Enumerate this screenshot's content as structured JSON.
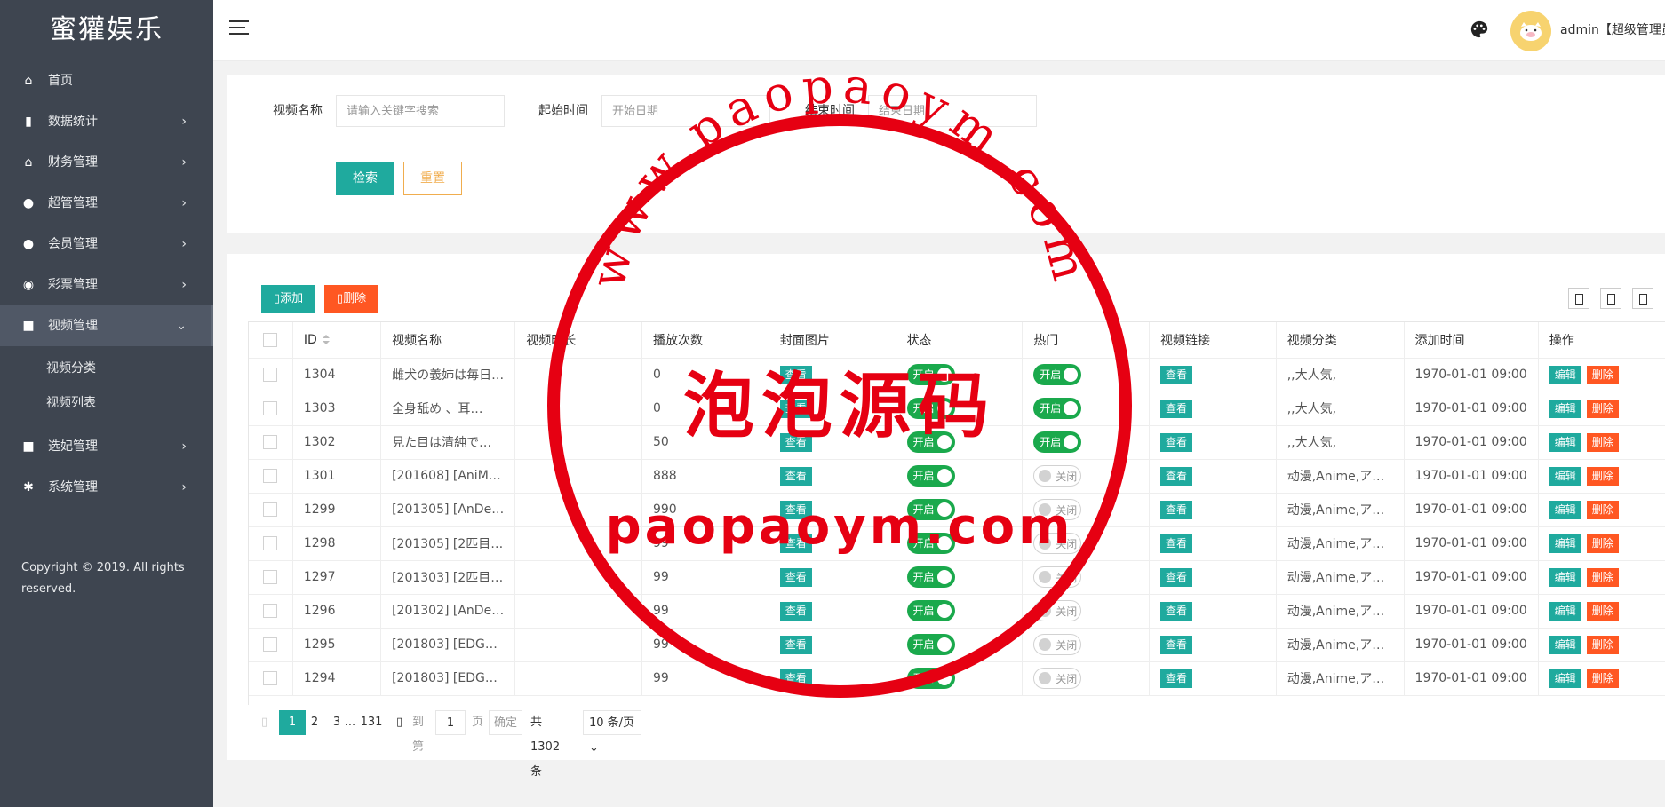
{
  "brand": "蜜獾娱乐",
  "sidebar": {
    "items": [
      {
        "label": "首页",
        "icon": "home-icon"
      },
      {
        "label": "数据统计",
        "icon": "bar-chart-icon"
      },
      {
        "label": "财务管理",
        "icon": "bank-icon"
      },
      {
        "label": "超管管理",
        "icon": "user-icon"
      },
      {
        "label": "会员管理",
        "icon": "users-icon"
      },
      {
        "label": "彩票管理",
        "icon": "gamepad-icon"
      },
      {
        "label": "视频管理",
        "icon": "video-icon"
      },
      {
        "label": "选妃管理",
        "icon": "video-icon"
      },
      {
        "label": "系统管理",
        "icon": "gear-icon"
      }
    ],
    "subitems": [
      "视频分类",
      "视频列表"
    ],
    "copyright": "Copyright © 2019. All rights reserved."
  },
  "header": {
    "user": "admin【超级管理员】"
  },
  "search": {
    "name_label": "视频名称",
    "name_placeholder": "请输入关键字搜索",
    "start_label": "起始时间",
    "start_placeholder": "开始日期",
    "end_label": "结束时间",
    "end_placeholder": "结束日期",
    "search_btn": "检索",
    "reset_btn": "重置"
  },
  "toolbar": {
    "add_label": "添加",
    "delete_label": "删除"
  },
  "table": {
    "columns": [
      "ID",
      "视频名称",
      "视频时长",
      "播放次数",
      "封面图片",
      "状态",
      "热门",
      "视频链接",
      "视频分类",
      "添加时间",
      "操作"
    ],
    "view_label": "查看",
    "on_label": "开启",
    "off_label": "关闭",
    "edit_label": "编辑",
    "delete_label": "删除",
    "rows": [
      {
        "id": "1304",
        "name": "雌犬の義姉は毎日…",
        "duration": "",
        "plays": "0",
        "status": true,
        "hot": true,
        "category": ",,大人気,",
        "added": "1970-01-01 09:00"
      },
      {
        "id": "1303",
        "name": "全身舐め 、耳…",
        "duration": "",
        "plays": "0",
        "status": true,
        "hot": true,
        "category": ",,大人気,",
        "added": "1970-01-01 09:00"
      },
      {
        "id": "1302",
        "name": "見た目は清純で…",
        "duration": "",
        "plays": "50",
        "status": true,
        "hot": true,
        "category": ",,大人気,",
        "added": "1970-01-01 09:00"
      },
      {
        "id": "1301",
        "name": "[201608] [AniM…",
        "duration": "",
        "plays": "888",
        "status": true,
        "hot": false,
        "category": "动漫,Anime,ア…",
        "added": "1970-01-01 09:00"
      },
      {
        "id": "1299",
        "name": "[201305] [AnDe…",
        "duration": "",
        "plays": "990",
        "status": true,
        "hot": false,
        "category": "动漫,Anime,ア…",
        "added": "1970-01-01 09:00"
      },
      {
        "id": "1298",
        "name": "[201305] [2匹目…",
        "duration": "",
        "plays": "99",
        "status": true,
        "hot": false,
        "category": "动漫,Anime,ア…",
        "added": "1970-01-01 09:00"
      },
      {
        "id": "1297",
        "name": "[201303] [2匹目…",
        "duration": "",
        "plays": "99",
        "status": true,
        "hot": false,
        "category": "动漫,Anime,ア…",
        "added": "1970-01-01 09:00"
      },
      {
        "id": "1296",
        "name": "[201302] [AnDe…",
        "duration": "",
        "plays": "99",
        "status": true,
        "hot": false,
        "category": "动漫,Anime,ア…",
        "added": "1970-01-01 09:00"
      },
      {
        "id": "1295",
        "name": "[201803] [EDG…",
        "duration": "",
        "plays": "99",
        "status": true,
        "hot": false,
        "category": "动漫,Anime,ア…",
        "added": "1970-01-01 09:00"
      },
      {
        "id": "1294",
        "name": "[201803] [EDG…",
        "duration": "",
        "plays": "99",
        "status": true,
        "hot": false,
        "category": "动漫,Anime,ア…",
        "added": "1970-01-01 09:00"
      }
    ]
  },
  "pager": {
    "pages": [
      "1",
      "2",
      "3",
      "...",
      "131"
    ],
    "goto_label": "到第",
    "page_input": "1",
    "page_unit": "页",
    "ok_label": "确定",
    "total": "共 1302 条",
    "per_page": "10 条/页"
  },
  "watermark": {
    "arc_text": "www.paopaoym.com",
    "main_text": "泡泡源码",
    "bottom_text": "paopaoym.com"
  },
  "colors": {
    "sidebar_bg": "#3e4550",
    "primary": "#1faa9e",
    "danger": "#ff5722",
    "switch_on": "#1aa94c",
    "stamp": "#e60012"
  }
}
